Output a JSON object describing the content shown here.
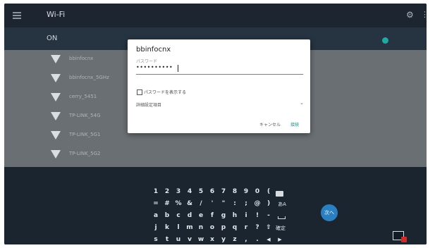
{
  "header": {
    "title": "Wi-Fi"
  },
  "toggle": {
    "label": "ON"
  },
  "networks": [
    {
      "name": "bbinfocnx"
    },
    {
      "name": "bbinfocnx_5GHz"
    },
    {
      "name": "cerry_5451"
    },
    {
      "name": "TP-LINK_54G"
    },
    {
      "name": "TP-LINK_5G1"
    },
    {
      "name": "TP-LINK_5G2"
    }
  ],
  "dialog": {
    "title": "bbinfocnx",
    "password_label": "パスワード",
    "password_value": "••••••••••",
    "show_password_label": "パスワードを表示する",
    "advanced_label": "詳細設定項目",
    "cancel_label": "キャンセル",
    "connect_label": "接続"
  },
  "keyboard": {
    "row1": [
      "1",
      "2",
      "3",
      "4",
      "5",
      "6",
      "7",
      "8",
      "9",
      "0",
      "("
    ],
    "row2": [
      "=",
      "#",
      "%",
      "&",
      "/",
      "'",
      "\"",
      ":",
      ";",
      "@",
      ")",
      "あA"
    ],
    "row3": [
      "a",
      "b",
      "c",
      "d",
      "e",
      "f",
      "g",
      "h",
      "i",
      "!",
      "-"
    ],
    "row4": [
      "j",
      "k",
      "l",
      "m",
      "n",
      "o",
      "p",
      "q",
      "r",
      "?",
      "確定"
    ],
    "row5": [
      "s",
      "t",
      "u",
      "v",
      "w",
      "x",
      "y",
      "z",
      ",",
      ".",
      "◀",
      "▶"
    ],
    "shift_label": "⇧",
    "next_label": "次へ"
  },
  "colors": {
    "accent": "#1fa8a4",
    "next_button": "#2a7fc0"
  }
}
